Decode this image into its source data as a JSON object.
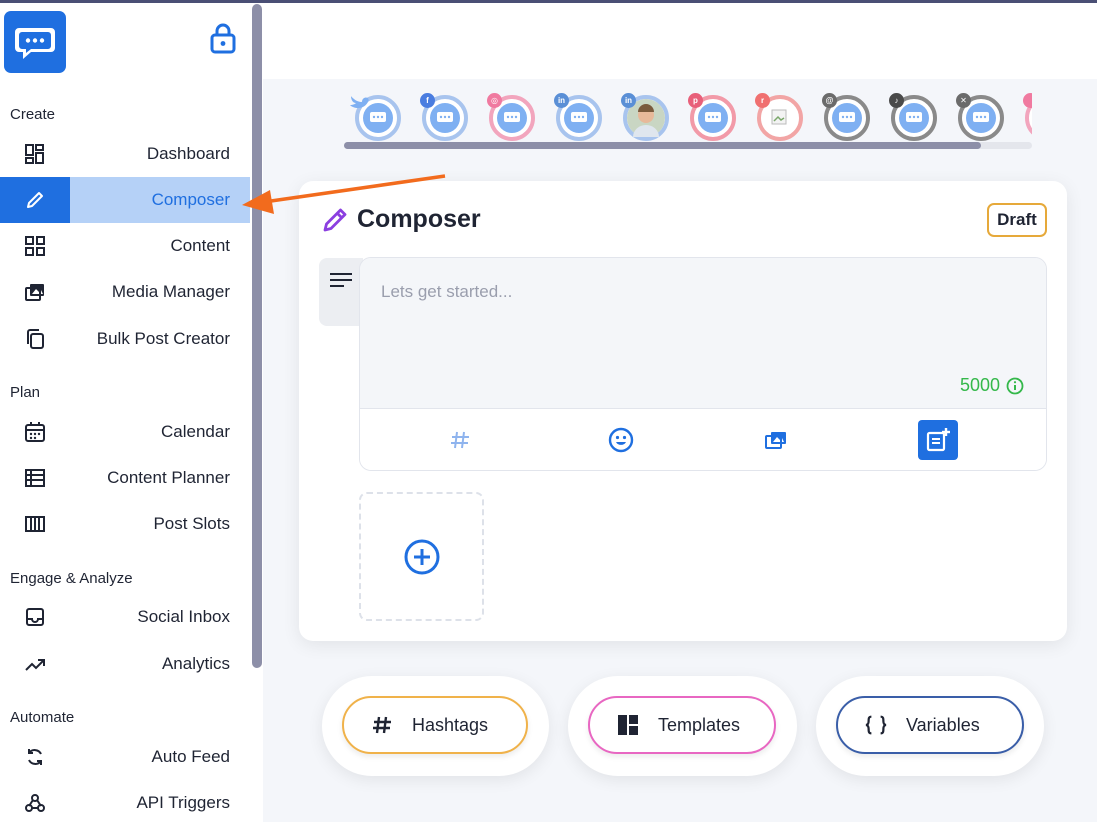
{
  "sidebar": {
    "sections": [
      {
        "label": "Create"
      },
      {
        "label": "Plan"
      },
      {
        "label": "Engage & Analyze"
      },
      {
        "label": "Automate"
      }
    ],
    "items": [
      {
        "label": "Dashboard",
        "icon": "dashboard-icon"
      },
      {
        "label": "Composer",
        "icon": "pencil-icon",
        "active": true
      },
      {
        "label": "Content",
        "icon": "grid-icon"
      },
      {
        "label": "Media Manager",
        "icon": "media-icon"
      },
      {
        "label": "Bulk Post Creator",
        "icon": "copy-icon"
      },
      {
        "label": "Calendar",
        "icon": "calendar-icon"
      },
      {
        "label": "Content Planner",
        "icon": "table-icon"
      },
      {
        "label": "Post Slots",
        "icon": "slots-icon"
      },
      {
        "label": "Social Inbox",
        "icon": "inbox-icon"
      },
      {
        "label": "Analytics",
        "icon": "trending-up-icon"
      },
      {
        "label": "Auto Feed",
        "icon": "refresh-icon"
      },
      {
        "label": "API Triggers",
        "icon": "webhook-icon"
      }
    ]
  },
  "accounts": [
    {
      "network": "twitter",
      "badge_color": "#7fb0f2",
      "ring": "#a8c4ee"
    },
    {
      "network": "facebook",
      "badge_color": "#4a7de0",
      "ring": "#a8c4ee"
    },
    {
      "network": "instagram",
      "badge_color": "#f07aa0",
      "ring": "#f2a5bd"
    },
    {
      "network": "linkedin",
      "badge_color": "#5a8fd6",
      "ring": "#a8c4ee"
    },
    {
      "network": "linkedin",
      "badge_color": "#5a8fd6",
      "ring": "#a8c4ee",
      "photo": true
    },
    {
      "network": "pinterest",
      "badge_color": "#e8607a",
      "ring": "#f29aa8"
    },
    {
      "network": "reddit",
      "badge_color": "#f07070",
      "ring": "#f2a5a5",
      "broken": true
    },
    {
      "network": "threads",
      "badge_color": "#6b6b6b",
      "ring": "#8a8a8a"
    },
    {
      "network": "tiktok",
      "badge_color": "#4a4a4a",
      "ring": "#8a8a8a"
    },
    {
      "network": "x",
      "badge_color": "#6b6b6b",
      "ring": "#8a8a8a"
    }
  ],
  "composer": {
    "title": "Composer",
    "status": "Draft",
    "placeholder": "Lets get started...",
    "char_limit": "5000"
  },
  "actions": [
    {
      "label": "Hashtags",
      "icon": "#",
      "border": "#f0b24a"
    },
    {
      "label": "Templates",
      "icon": "templates-icon",
      "border": "#e867c2"
    },
    {
      "label": "Variables",
      "icon": "{ }",
      "border": "#3a5ea8"
    }
  ],
  "colors": {
    "primary": "#1f6fe0",
    "active_bg": "#b5d1f7",
    "success": "#34b84a",
    "arrow": "#f26b1d"
  }
}
